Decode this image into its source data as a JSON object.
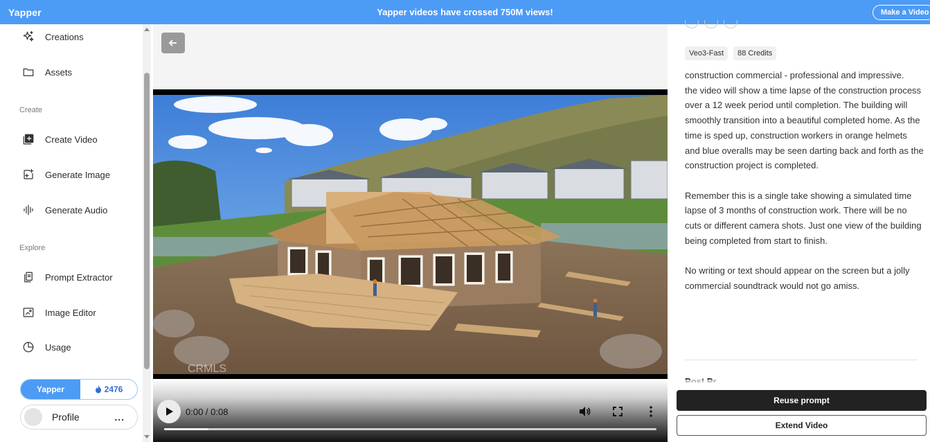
{
  "banner": {
    "logo": "Yapper",
    "announcement": "Yapper videos have crossed 750M views!",
    "cta_label": "Make a Video"
  },
  "sidebar": {
    "top_items": [
      {
        "label": "Creations",
        "icon": "sparkle-icon"
      },
      {
        "label": "Assets",
        "icon": "folder-icon"
      }
    ],
    "sections": [
      {
        "title": "Create",
        "items": [
          {
            "label": "Create Video",
            "icon": "add-video-icon"
          },
          {
            "label": "Generate Image",
            "icon": "image-plus-icon"
          },
          {
            "label": "Generate Audio",
            "icon": "waveform-icon"
          }
        ]
      },
      {
        "title": "Explore",
        "items": [
          {
            "label": "Prompt Extractor",
            "icon": "document-copy-icon"
          },
          {
            "label": "Image Editor",
            "icon": "image-edit-icon"
          },
          {
            "label": "Usage",
            "icon": "pie-chart-icon"
          }
        ]
      }
    ],
    "toggle": {
      "left_label": "Yapper",
      "credits": "2476"
    },
    "profile": {
      "name": "Profile",
      "menu": "..."
    }
  },
  "player": {
    "time": "0:00 / 0:08",
    "progress_fraction": 0.09,
    "watermark": "CRMLS"
  },
  "details": {
    "badges": [
      "Veo3-Fast",
      "88 Credits"
    ],
    "prompt": "construction commercial - professional and impressive.\nthe video will show a time lapse of the construction process over a 12 week period until completion. The building will smoothly transition into a beautiful completed home. As the time is sped up, construction workers in orange helmets and blue overalls may be seen darting back and forth as the construction project is completed.\n\nRemember this is a single take showing a simulated time lapse of 3 months of construction work. There will be no cuts or different camera shots. Just one view of the building being completed from start to finish.\n\nNo writing or text should appear on the screen but a jolly commercial soundtrack would not go amiss.",
    "next_section_title": "Post Pr",
    "reuse_label": "Reuse prompt",
    "extend_label": "Extend Video"
  }
}
